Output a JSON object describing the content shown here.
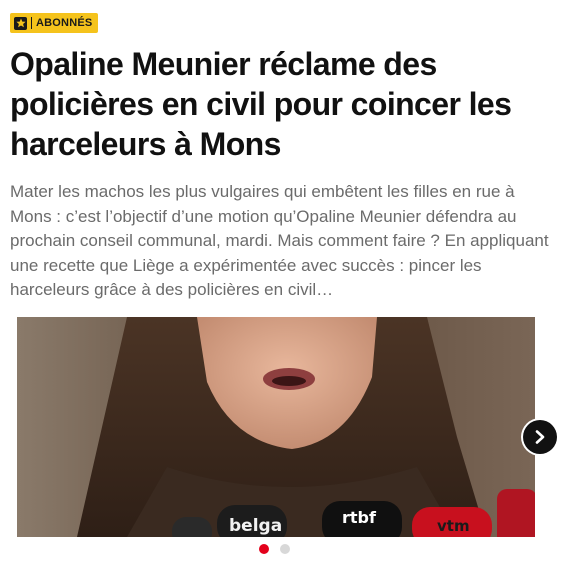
{
  "badge": {
    "label": "ABONNÉS",
    "icon": "star-icon",
    "color": "#f5c31c"
  },
  "article": {
    "title": "Opaline Meunier réclame des policières en civil pour coincer les harceleurs à Mons",
    "summary": "Mater les machos les plus vulgaires qui embêtent les filles en rue à Mons : c’est l’objectif d’une motion qu’Opaline Meunier défendra au prochain conseil communal, mardi. Mais comment faire ? En appliquant une recette que Liège a expérimentée avec succès : pincer les harceleurs grâce à des policières en civil…"
  },
  "gallery": {
    "microphone_labels": [
      "belga",
      "rtbf",
      "vtm"
    ],
    "next_icon": "chevron-right-icon",
    "active_index": 1,
    "total_slides": 2,
    "active_dot_color": "#e3001b"
  }
}
